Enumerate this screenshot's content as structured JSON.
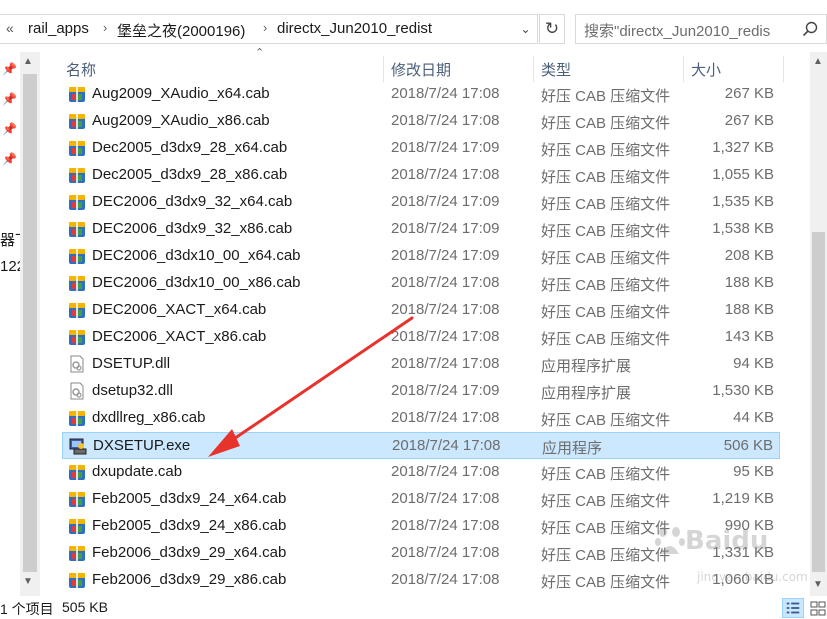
{
  "address": {
    "chevrons": "«",
    "crumbs": [
      "rail_apps",
      "堡垒之夜(2000196)",
      "directx_Jun2010_redist"
    ],
    "separator": "›",
    "dropdown": "⌄",
    "refresh": "↻"
  },
  "search": {
    "placeholder": "搜索\"directx_Jun2010_redis"
  },
  "navpane": {
    "cut_text_1": "器丅",
    "cut_text_2": "122"
  },
  "columns": {
    "name": "名称",
    "date": "修改日期",
    "type": "类型",
    "size": "大小"
  },
  "files": [
    {
      "name": "Aug2009_XAudio_x64.cab",
      "date": "2018/7/24 17:08",
      "type": "好压 CAB 压缩文件",
      "size": "267 KB",
      "icon": "cab-archive-icon"
    },
    {
      "name": "Aug2009_XAudio_x86.cab",
      "date": "2018/7/24 17:08",
      "type": "好压 CAB 压缩文件",
      "size": "267 KB",
      "icon": "cab-archive-icon"
    },
    {
      "name": "Dec2005_d3dx9_28_x64.cab",
      "date": "2018/7/24 17:09",
      "type": "好压 CAB 压缩文件",
      "size": "1,327 KB",
      "icon": "cab-archive-icon"
    },
    {
      "name": "Dec2005_d3dx9_28_x86.cab",
      "date": "2018/7/24 17:08",
      "type": "好压 CAB 压缩文件",
      "size": "1,055 KB",
      "icon": "cab-archive-icon"
    },
    {
      "name": "DEC2006_d3dx9_32_x64.cab",
      "date": "2018/7/24 17:09",
      "type": "好压 CAB 压缩文件",
      "size": "1,535 KB",
      "icon": "cab-archive-icon"
    },
    {
      "name": "DEC2006_d3dx9_32_x86.cab",
      "date": "2018/7/24 17:09",
      "type": "好压 CAB 压缩文件",
      "size": "1,538 KB",
      "icon": "cab-archive-icon"
    },
    {
      "name": "DEC2006_d3dx10_00_x64.cab",
      "date": "2018/7/24 17:09",
      "type": "好压 CAB 压缩文件",
      "size": "208 KB",
      "icon": "cab-archive-icon"
    },
    {
      "name": "DEC2006_d3dx10_00_x86.cab",
      "date": "2018/7/24 17:08",
      "type": "好压 CAB 压缩文件",
      "size": "188 KB",
      "icon": "cab-archive-icon"
    },
    {
      "name": "DEC2006_XACT_x64.cab",
      "date": "2018/7/24 17:08",
      "type": "好压 CAB 压缩文件",
      "size": "188 KB",
      "icon": "cab-archive-icon"
    },
    {
      "name": "DEC2006_XACT_x86.cab",
      "date": "2018/7/24 17:08",
      "type": "好压 CAB 压缩文件",
      "size": "143 KB",
      "icon": "cab-archive-icon"
    },
    {
      "name": "DSETUP.dll",
      "date": "2018/7/24 17:08",
      "type": "应用程序扩展",
      "size": "94 KB",
      "icon": "dll-file-icon"
    },
    {
      "name": "dsetup32.dll",
      "date": "2018/7/24 17:09",
      "type": "应用程序扩展",
      "size": "1,530 KB",
      "icon": "dll-file-icon"
    },
    {
      "name": "dxdllreg_x86.cab",
      "date": "2018/7/24 17:08",
      "type": "好压 CAB 压缩文件",
      "size": "44 KB",
      "icon": "cab-archive-icon"
    },
    {
      "name": "DXSETUP.exe",
      "date": "2018/7/24 17:08",
      "type": "应用程序",
      "size": "506 KB",
      "icon": "setup-exe-icon",
      "selected": true
    },
    {
      "name": "dxupdate.cab",
      "date": "2018/7/24 17:08",
      "type": "好压 CAB 压缩文件",
      "size": "95 KB",
      "icon": "cab-archive-icon"
    },
    {
      "name": "Feb2005_d3dx9_24_x64.cab",
      "date": "2018/7/24 17:08",
      "type": "好压 CAB 压缩文件",
      "size": "1,219 KB",
      "icon": "cab-archive-icon"
    },
    {
      "name": "Feb2005_d3dx9_24_x86.cab",
      "date": "2018/7/24 17:08",
      "type": "好压 CAB 压缩文件",
      "size": "990 KB",
      "icon": "cab-archive-icon"
    },
    {
      "name": "Feb2006_d3dx9_29_x64.cab",
      "date": "2018/7/24 17:08",
      "type": "好压 CAB 压缩文件",
      "size": "1,331 KB",
      "icon": "cab-archive-icon"
    },
    {
      "name": "Feb2006_d3dx9_29_x86.cab",
      "date": "2018/7/24 17:08",
      "type": "好压 CAB 压缩文件",
      "size": "1,060 KB",
      "icon": "cab-archive-icon"
    }
  ],
  "status": {
    "selected": "1 个项目",
    "size": "505 KB"
  },
  "watermark": {
    "logo": "Baidu",
    "sub": "jingyan.baidu.com"
  },
  "colors": {
    "selection_bg": "#cce8ff",
    "selection_border": "#99d1ff",
    "arrow": "#e8322c",
    "header_text": "#4c607a"
  }
}
